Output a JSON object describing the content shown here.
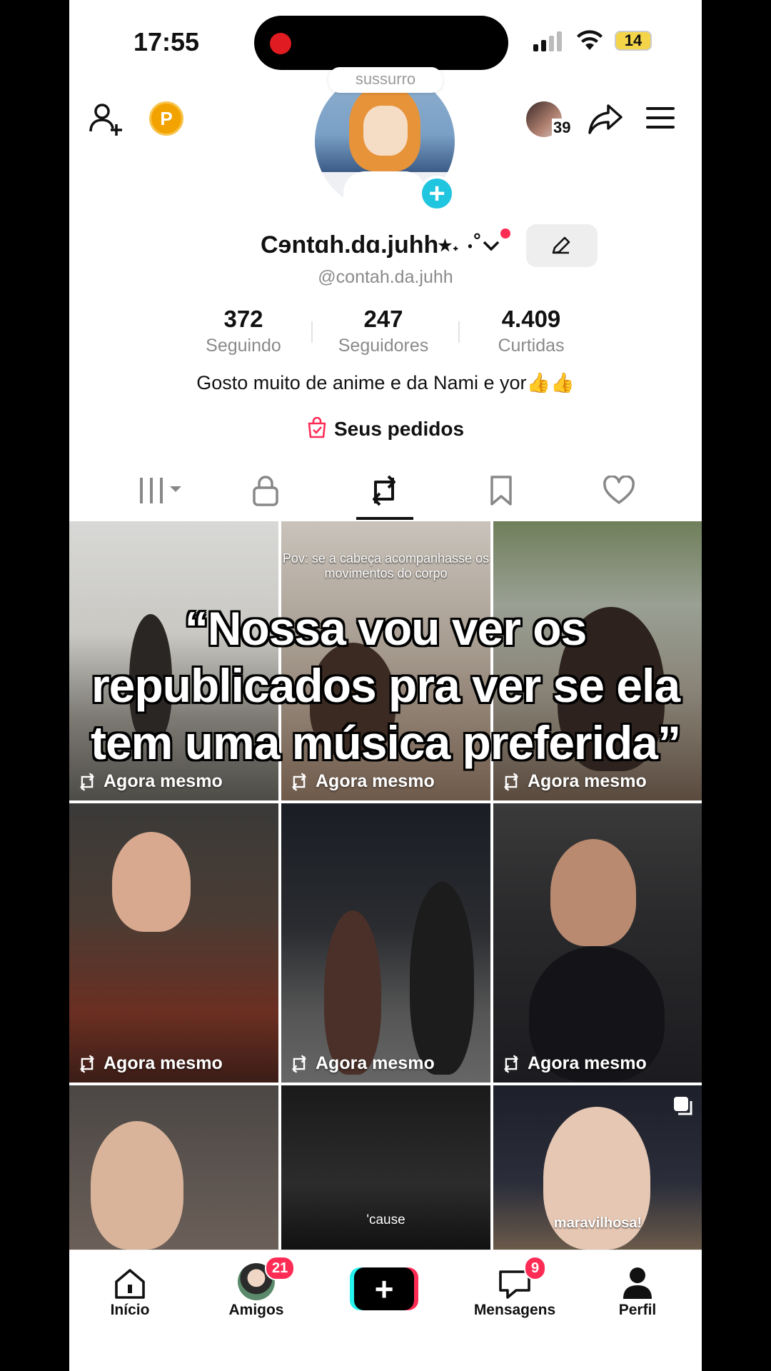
{
  "status": {
    "time": "17:55",
    "battery": "14"
  },
  "profile": {
    "whisper_label": "sussurro",
    "name": "Cɘntɑh.dɑ.juhh⭑˖ ⋅˚",
    "handle": "@contah.da.juhh",
    "visitor_count": "39",
    "coin_label": "P",
    "stats": [
      {
        "value": "372",
        "label": "Seguindo"
      },
      {
        "value": "247",
        "label": "Seguidores"
      },
      {
        "value": "4.409",
        "label": "Curtidas"
      }
    ],
    "bio": "Gosto muito de anime e da Nami e yor👍👍",
    "orders_label": "Seus pedidos"
  },
  "tabs": [
    {
      "icon": "grid-icon",
      "active": false
    },
    {
      "icon": "lock-icon",
      "active": false
    },
    {
      "icon": "repost-icon",
      "active": true
    },
    {
      "icon": "bookmark-icon",
      "active": false
    },
    {
      "icon": "heart-icon",
      "active": false
    }
  ],
  "grid": {
    "items": [
      {
        "meta": "Agora mesmo",
        "caption": ""
      },
      {
        "meta": "Agora mesmo",
        "caption": "Pov: se a cabeça acompanhasse os movimentos do corpo"
      },
      {
        "meta": "Agora mesmo",
        "caption": ""
      },
      {
        "meta": "Agora mesmo",
        "caption": ""
      },
      {
        "meta": "Agora mesmo",
        "caption": ""
      },
      {
        "meta": "Agora mesmo",
        "caption": ""
      },
      {
        "meta": "",
        "caption": ""
      },
      {
        "meta": "",
        "caption": "'cause"
      },
      {
        "meta": "",
        "caption": "maravilhosa!"
      }
    ]
  },
  "overlay_text": "“Nossa vou ver os republicados pra ver se ela tem uma música preferida”",
  "nav": {
    "home": "Início",
    "friends": "Amigos",
    "friends_badge": "21",
    "messages": "Mensagens",
    "messages_badge": "9",
    "profile": "Perfil"
  },
  "colors": {
    "accent": "#fe2c55",
    "teal": "#25f4ee",
    "plus_badge": "#20c5e0"
  }
}
